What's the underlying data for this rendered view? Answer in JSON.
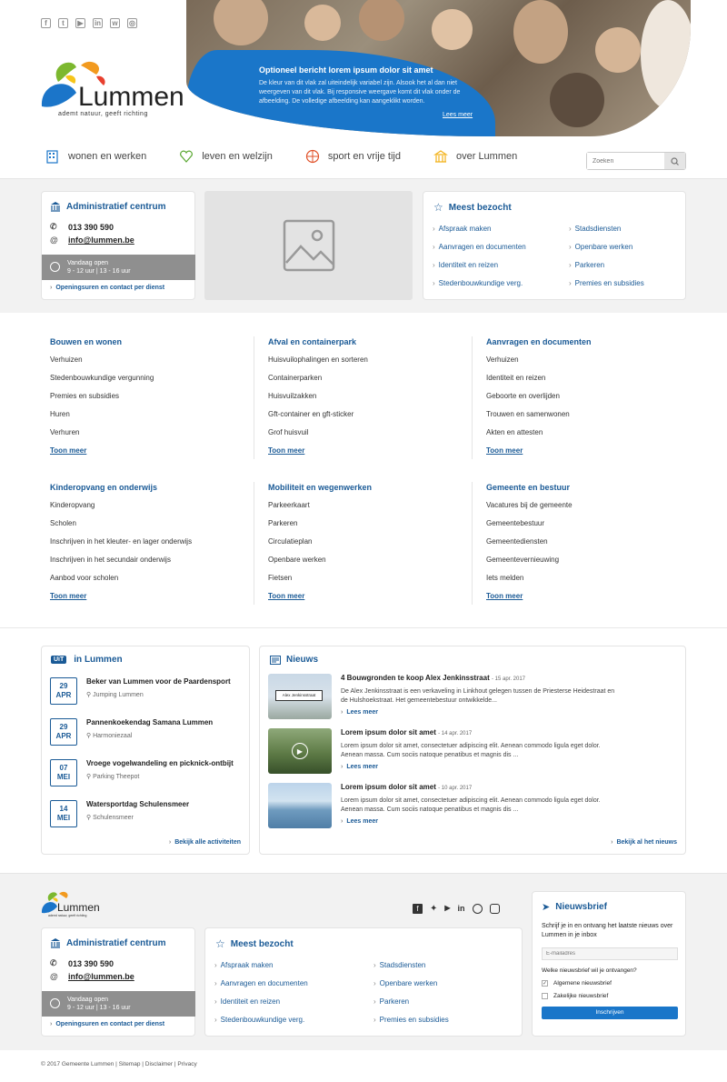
{
  "social_icons": [
    "facebook-icon",
    "twitter-icon",
    "youtube-icon",
    "linkedin-icon",
    "whatsapp-icon",
    "instagram-icon"
  ],
  "brand": {
    "name": "Lummen",
    "tagline": "ademt natuur, geeft richting"
  },
  "hero": {
    "title": "Optioneel bericht lorem ipsum dolor sit amet",
    "text": "De kleur van dit vlak zal uiteindelijk variabel zijn. Alsook het al dan niet weergeven van dit vlak. Bij responsive weergave komt dit vlak onder de afbeelding. De volledige afbeelding kan aangeklikt worden.",
    "link": "Lees meer"
  },
  "nav": [
    {
      "label": "wonen en werken",
      "icon": "building-icon"
    },
    {
      "label": "leven en welzijn",
      "icon": "heart-icon"
    },
    {
      "label": "sport en vrije tijd",
      "icon": "ball-icon"
    },
    {
      "label": "over Lummen",
      "icon": "townhall-icon"
    }
  ],
  "search": {
    "placeholder": "Zoeken"
  },
  "admin": {
    "title": "Administratief centrum",
    "phone": "013 390 590",
    "email": "info@lummen.be",
    "open_label": "Vandaag open",
    "hours": "9 - 12 uur | 13 - 16 uur",
    "link": "Openingsuren en contact per dienst"
  },
  "meest_bezocht": {
    "title": "Meest bezocht",
    "col1": [
      "Afspraak maken",
      "Aanvragen en documenten",
      "Identiteit en reizen",
      "Stedenbouwkundige verg."
    ],
    "col2": [
      "Stadsdiensten",
      "Openbare werken",
      "Parkeren",
      "Premies en subsidies"
    ]
  },
  "categories": [
    {
      "title": "Bouwen en wonen",
      "items": [
        "Verhuizen",
        "Stedenbouwkundige vergunning",
        "Premies en subsidies",
        "Huren",
        "Verhuren"
      ]
    },
    {
      "title": "Afval en containerpark",
      "items": [
        "Huisvuilophalingen en sorteren",
        "Containerparken",
        "Huisvuilzakken",
        "Gft-container en gft-sticker",
        "Grof huisvuil"
      ]
    },
    {
      "title": "Aanvragen en documenten",
      "items": [
        "Verhuizen",
        "Identiteit en reizen",
        "Geboorte en overlijden",
        "Trouwen en samenwonen",
        "Akten en attesten"
      ]
    },
    {
      "title": "Kinderopvang en onderwijs",
      "items": [
        "Kinderopvang",
        "Scholen",
        "Inschrijven in het kleuter- en lager onderwijs",
        "Inschrijven in het secundair onderwijs",
        "Aanbod voor scholen"
      ]
    },
    {
      "title": "Mobiliteit en wegenwerken",
      "items": [
        "Parkeerkaart",
        "Parkeren",
        "Circulatieplan",
        "Openbare werken",
        "Fietsen"
      ]
    },
    {
      "title": "Gemeente en bestuur",
      "items": [
        "Vacatures bij de gemeente",
        "Gemeentebestuur",
        "Gemeentediensten",
        "Gemeentevernieuwing",
        "Iets melden"
      ]
    }
  ],
  "toon_meer": "Toon meer",
  "uit": {
    "badge": "UiT",
    "title": "in Lummen",
    "events": [
      {
        "day": "29",
        "month": "APR",
        "title": "Beker van Lummen voor de Paardensport",
        "loc": "Jumping Lummen"
      },
      {
        "day": "29",
        "month": "APR",
        "title": "Pannenkoekendag Samana Lummen",
        "loc": "Harmoniezaal"
      },
      {
        "day": "07",
        "month": "MEI",
        "title": "Vroege vogelwandeling en picknick-ontbijt",
        "loc": "Parking Theepot"
      },
      {
        "day": "14",
        "month": "MEI",
        "title": "Watersportdag Schulensmeer",
        "loc": "Schulensmeer"
      }
    ],
    "link": "Bekijk alle activiteiten"
  },
  "nieuws": {
    "title": "Nieuws",
    "items": [
      {
        "title": "4 Bouwgronden te koop Alex Jenkinsstraat",
        "date": "- 15 apr. 2017",
        "text": "De Alex Jenkinsstraat is een verkaveling in Linkhout gelegen tussen de Priesterse Heidestraat en de Hulshoekstraat. Het gemeentebestuur ontwikkelde...",
        "more": "Lees meer",
        "sign": "Alex Jenkinsstraat"
      },
      {
        "title": "Lorem ipsum dolor sit amet",
        "date": "- 14 apr. 2017",
        "text": "Lorem ipsum dolor sit amet, consectetuer adipiscing elit. Aenean commodo ligula eget dolor. Aenean massa. Cum sociis natoque penatibus et magnis dis ...",
        "more": "Lees meer"
      },
      {
        "title": "Lorem ipsum dolor sit amet",
        "date": "- 10 apr. 2017",
        "text": "Lorem ipsum dolor sit amet, consectetuer adipiscing elit. Aenean commodo ligula eget dolor. Aenean massa. Cum sociis natoque penatibus et magnis dis ...",
        "more": "Lees meer"
      }
    ],
    "link": "Bekijk al het nieuws"
  },
  "newsletter": {
    "title": "Nieuwsbrief",
    "text": "Schrijf je in en ontvang het laatste nieuws over Lummen in je inbox",
    "placeholder": "E-mailadres",
    "question": "Welke nieuwsbrief wil je ontvangen?",
    "opt1": "Algemene nieuwsbrief",
    "opt2": "Zakelijke nieuwsbrief",
    "button": "Inschrijven"
  },
  "copyright": "© 2017 Gemeente Lummen | Sitemap | Disclaimer | Privacy",
  "colors": {
    "accent": "#1a5a96",
    "hero_blue": "#1a76c9",
    "button": "#1a76c9"
  }
}
